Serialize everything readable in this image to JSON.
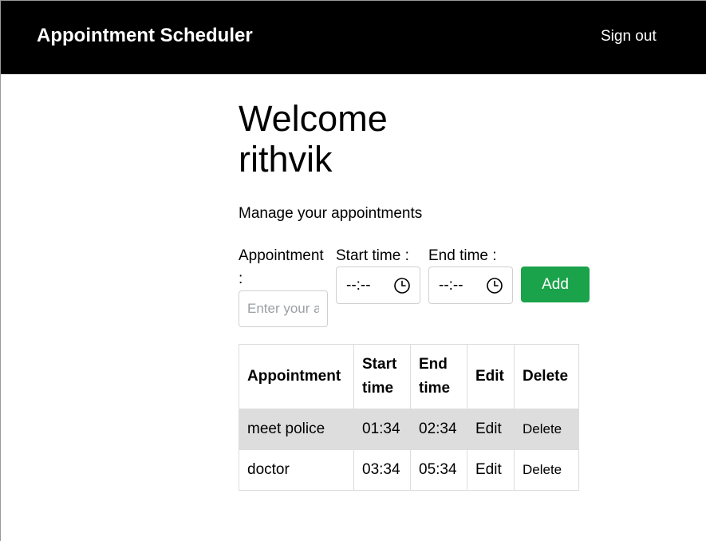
{
  "navbar": {
    "brand": "Appointment Scheduler",
    "signout_label": "Sign out"
  },
  "welcome": {
    "heading": "Welcome rithvik",
    "subtitle": "Manage your appointments"
  },
  "form": {
    "appointment_label": "Appointment :",
    "appointment_placeholder": "Enter your appointment",
    "appointment_value": "",
    "start_label": "Start time :",
    "start_value": "--:--",
    "end_label": "End time :",
    "end_value": "--:--",
    "add_label": "Add",
    "icons": {
      "time_picker": "clock-icon"
    }
  },
  "table": {
    "headers": {
      "appointment": "Appointment",
      "start": "Start time",
      "end": "End time",
      "edit": "Edit",
      "delete": "Delete"
    },
    "rows": [
      {
        "appointment": "meet police",
        "start": "01:34",
        "end": "02:34",
        "edit": "Edit",
        "delete": "Delete"
      },
      {
        "appointment": "doctor",
        "start": "03:34",
        "end": "05:34",
        "edit": "Edit",
        "delete": "Delete"
      }
    ]
  },
  "colors": {
    "navbar_bg": "#000000",
    "add_button_bg": "#1aa34a",
    "shaded_row_bg": "#dddddd"
  }
}
